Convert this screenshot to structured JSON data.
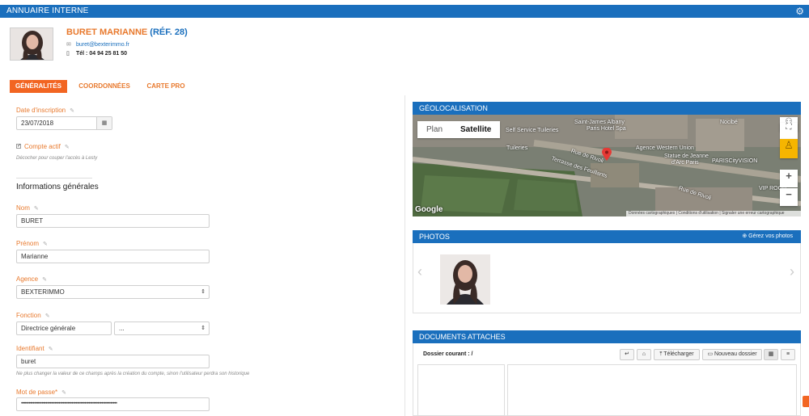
{
  "header": {
    "title": "ANNUAIRE INTERNE",
    "settings_icon": "gear-icon"
  },
  "profile": {
    "name": "BURET MARIANNE",
    "ref": "(RÉF. 28)",
    "email": "buret@bexterimmo.fr",
    "phone": "Tél : 04 94 25 81 50"
  },
  "tabs": [
    {
      "label": "GÉNÉRALITÉS",
      "active": true
    },
    {
      "label": "COORDONNÉES",
      "active": false
    },
    {
      "label": "CARTE PRO",
      "active": false
    }
  ],
  "form": {
    "inscription_label": "Date d'inscription",
    "inscription_value": "23/07/2018",
    "compte_actif_label": "Compte actif",
    "compte_actif_checked": true,
    "compte_actif_hint": "Décocher pour couper l'accès à Lesty",
    "section_title": "Informations générales",
    "nom_label": "Nom",
    "nom_value": "BURET",
    "prenom_label": "Prénom",
    "prenom_value": "Marianne",
    "agence_label": "Agence",
    "agence_value": "BEXTERIMMO",
    "fonction_label": "Fonction",
    "fonction_value": "Directrice générale",
    "fonction_extra_value": "...",
    "identifiant_label": "Identifiant",
    "identifiant_value": "buret",
    "identifiant_hint": "Ne plus changer la valeur de ce champs après la création du compte, sinon l'utilisateur perdra son historique",
    "password_label": "Mot de passe*",
    "password_value": "••••••••••••••••••••••••••••••••••••••••••••••••••••••••••••••••••••••••••"
  },
  "geolocalisation": {
    "title": "GÉOLOCALISATION",
    "map_type_plan": "Plan",
    "map_type_satellite": "Satellite",
    "zoom_in": "+",
    "zoom_out": "−",
    "google_logo": "Google",
    "footer_1": "Données cartographiques",
    "footer_2": "Conditions d'utilisation",
    "footer_3": "Signaler une erreur cartographique",
    "labels": {
      "self_service": "Self Service Tuileries",
      "saint_james": "Saint-James Albany",
      "hotel_spa": "Paris Hotel Spa",
      "tuileries": "Tuileries",
      "rue_rivoli": "Rue de Rivoli",
      "terrasse": "Terrasse des Feuillants",
      "agence": "Agence Western Union",
      "statue": "Statue de Jeanne",
      "statue2": "d'Arc Paris",
      "nocibe": "Nocibé",
      "paris_vision": "PARISCityVISION",
      "vip": "VIP ROOM",
      "rue_rivoli2": "Rue de Rivoli"
    }
  },
  "photos": {
    "title": "PHOTOS",
    "manage": "Gérez vos photos"
  },
  "documents": {
    "title": "DOCUMENTS ATTACHES",
    "current_folder_label": "Dossier courant :",
    "current_folder_value": "/",
    "download": "Télécharger",
    "new_folder": "Nouveau dossier"
  }
}
